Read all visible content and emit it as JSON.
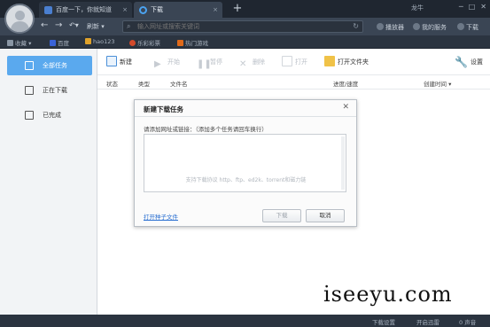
{
  "titlebar": {
    "tabs": [
      {
        "label": "百度一下，你就知道"
      },
      {
        "label": "下载"
      }
    ],
    "new_tab": "+",
    "user": "龙牛",
    "window_buttons": [
      "─",
      "□",
      "✕"
    ]
  },
  "navbar": {
    "refresh_label": "刷新",
    "search_placeholder": "输入网址或搜索关键词",
    "right_items": [
      "播放器",
      "我的服务",
      "下载"
    ]
  },
  "bookmarks": [
    {
      "label": "收藏",
      "color": "#8a96a4"
    },
    {
      "label": "百度",
      "color": "#3a63d8"
    },
    {
      "label": "hao123",
      "color": "#e0a22a"
    },
    {
      "label": "乐彩彩票",
      "color": "#d34a2b"
    },
    {
      "label": "热门游戏",
      "color": "#e06a1a"
    }
  ],
  "sidebar": {
    "items": [
      {
        "label": "全部任务",
        "selected": true
      },
      {
        "label": "正在下载",
        "selected": false
      },
      {
        "label": "已完成",
        "selected": false
      }
    ]
  },
  "toolbar": {
    "new": "新建",
    "start": "开始",
    "pause": "暂停",
    "delete": "删除",
    "open": "打开",
    "open_folder": "打开文件夹",
    "settings": "设置"
  },
  "columns": {
    "status": "状态",
    "type": "类型",
    "filename": "文件名",
    "progress": "进度/速度",
    "created": "创建时间"
  },
  "dialog": {
    "title": "新建下载任务",
    "close": "✕",
    "hint": "请添加网址或链接：（添加多个任务请回车换行）",
    "placeholder": "支持下载协议 http、ftp、ed2k、torrent和磁力链",
    "torrent_link": "打开种子文件",
    "download_button": "下载",
    "cancel_button": "取消"
  },
  "statusbar": {
    "left": "下载设置",
    "middle": "开启迅雷",
    "right": "0 声音"
  },
  "watermark": "iseeyu.com"
}
